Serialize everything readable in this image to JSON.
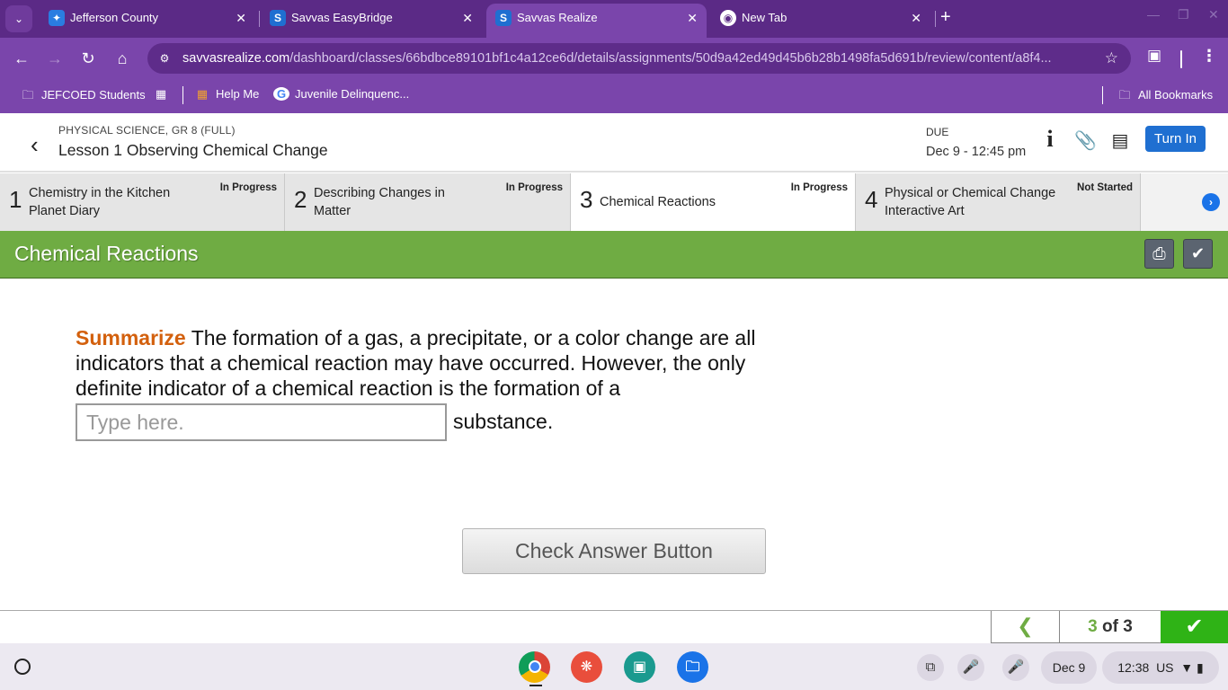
{
  "browser": {
    "tabs": [
      {
        "title": "Jefferson County",
        "icon": "jefferson-county-icon",
        "active": false
      },
      {
        "title": "Savvas EasyBridge",
        "icon": "savvas-icon",
        "active": false
      },
      {
        "title": "Savvas Realize",
        "icon": "savvas-icon",
        "active": true
      },
      {
        "title": "New Tab",
        "icon": "chrome-icon",
        "active": false
      }
    ],
    "url_host": "savvasrealize.com",
    "url_path": "/dashboard/classes/66bdbce89101bf1c4a12ce6d/details/assignments/50d9a42ed49d45b6b28b1498fa5d691b/review/content/a8f4...",
    "bookmarks": [
      {
        "label": "JEFCOED Students"
      },
      {
        "label": "Help Me"
      },
      {
        "label": "Juvenile Delinquenc..."
      }
    ],
    "all_bookmarks": "All Bookmarks"
  },
  "header": {
    "course": "PHYSICAL SCIENCE, GR 8 (FULL)",
    "lesson": "Lesson 1 Observing Chemical Change",
    "due_label": "DUE",
    "due_date": "Dec 9 - 12:45 pm",
    "turn_in": "Turn In"
  },
  "steps": [
    {
      "num": "1",
      "name": "Chemistry in the Kitchen Planet Diary",
      "status": "In Progress"
    },
    {
      "num": "2",
      "name": "Describing Changes in Matter",
      "status": "In Progress"
    },
    {
      "num": "3",
      "name": "Chemical Reactions",
      "status": "In Progress"
    },
    {
      "num": "4",
      "name": "Physical or Chemical Change Interactive Art",
      "status": "Not Started"
    }
  ],
  "content": {
    "title": "Chemical Reactions",
    "keyword": "Summarize",
    "question": " The formation of a gas, a precipitate, or a color change are all indicators that a chemical reaction may have occurred. However, the only definite indicator of a chemical reaction is the formation of a",
    "input_placeholder": "Type here.",
    "input_value": "",
    "after_input": "substance.",
    "check_button": "Check Answer Button"
  },
  "pager": {
    "current": "3",
    "of_label": "of 3"
  },
  "shelf": {
    "date": "Dec 9",
    "time": "12:38",
    "locale": "US"
  },
  "colors": {
    "browser_chrome": "#7a45ab",
    "title_bar": "#6fac43",
    "keyword": "#d3600d",
    "turn_in": "#1f6fd1",
    "done_button": "#2fb316"
  }
}
